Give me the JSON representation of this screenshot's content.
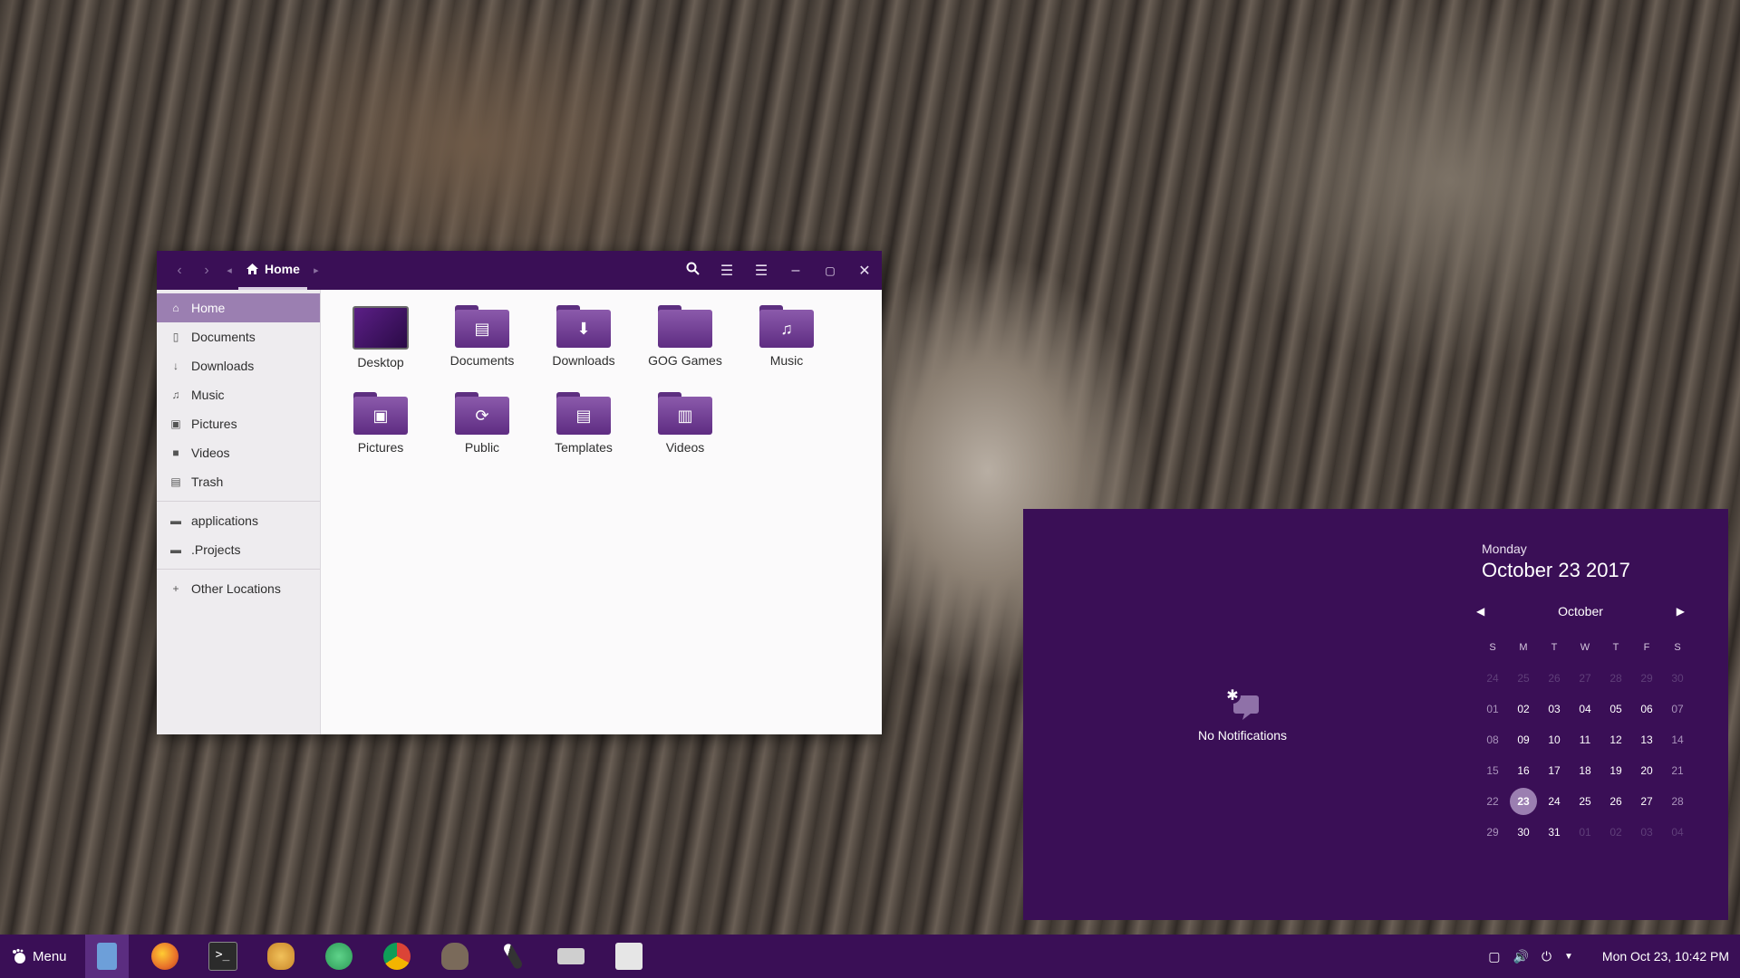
{
  "window": {
    "location": "Home",
    "sidebar": [
      {
        "icon": "home-icon",
        "label": "Home",
        "active": true
      },
      {
        "icon": "document-icon",
        "label": "Documents"
      },
      {
        "icon": "download-icon",
        "label": "Downloads"
      },
      {
        "icon": "music-icon",
        "label": "Music"
      },
      {
        "icon": "camera-icon",
        "label": "Pictures"
      },
      {
        "icon": "video-icon",
        "label": "Videos"
      },
      {
        "icon": "trash-icon",
        "label": "Trash"
      },
      {
        "icon": "folder-icon",
        "label": "applications"
      },
      {
        "icon": "folder-icon",
        "label": ".Projects"
      },
      {
        "icon": "plus-icon",
        "label": "Other Locations"
      }
    ],
    "files": [
      {
        "name": "Desktop",
        "glyph": ""
      },
      {
        "name": "Documents",
        "glyph": "▤"
      },
      {
        "name": "Downloads",
        "glyph": "⬇"
      },
      {
        "name": "GOG Games",
        "glyph": ""
      },
      {
        "name": "Music",
        "glyph": "♫"
      },
      {
        "name": "Pictures",
        "glyph": "▣"
      },
      {
        "name": "Public",
        "glyph": "⟳"
      },
      {
        "name": "Templates",
        "glyph": "▤"
      },
      {
        "name": "Videos",
        "glyph": "▥"
      }
    ]
  },
  "notifications": {
    "empty_text": "No Notifications"
  },
  "calendar": {
    "weekday": "Monday",
    "full_date": "October 23 2017",
    "month": "October",
    "day_headers": [
      "S",
      "M",
      "T",
      "W",
      "T",
      "F",
      "S"
    ],
    "weeks": [
      [
        "24",
        "25",
        "26",
        "27",
        "28",
        "29",
        "30"
      ],
      [
        "01",
        "02",
        "03",
        "04",
        "05",
        "06",
        "07"
      ],
      [
        "08",
        "09",
        "10",
        "11",
        "12",
        "13",
        "14"
      ],
      [
        "15",
        "16",
        "17",
        "18",
        "19",
        "20",
        "21"
      ],
      [
        "22",
        "23",
        "24",
        "25",
        "26",
        "27",
        "28"
      ],
      [
        "29",
        "30",
        "31",
        "01",
        "02",
        "03",
        "04"
      ]
    ],
    "today": "23"
  },
  "taskbar": {
    "menu_label": "Menu",
    "launchers": [
      {
        "name": "files",
        "color": "#6d9fd9",
        "active": true
      },
      {
        "name": "firefox",
        "color": "#e8712a"
      },
      {
        "name": "terminal",
        "color": "#2b2b2b"
      },
      {
        "name": "app-mascot",
        "color": "#e0a43a"
      },
      {
        "name": "app-green",
        "color": "#39b86b"
      },
      {
        "name": "app-chrome",
        "color": "#d84a3a"
      },
      {
        "name": "gimp",
        "color": "#7a6a5a"
      },
      {
        "name": "inkscape",
        "color": "#333333"
      },
      {
        "name": "app-keyboard",
        "color": "#bfbfbf"
      },
      {
        "name": "app-mixer",
        "color": "#dddddd"
      }
    ],
    "clock": "Mon Oct 23, 10:42 PM"
  },
  "colors": {
    "accent": "#3a0f56",
    "selection": "#9b7fb1"
  }
}
